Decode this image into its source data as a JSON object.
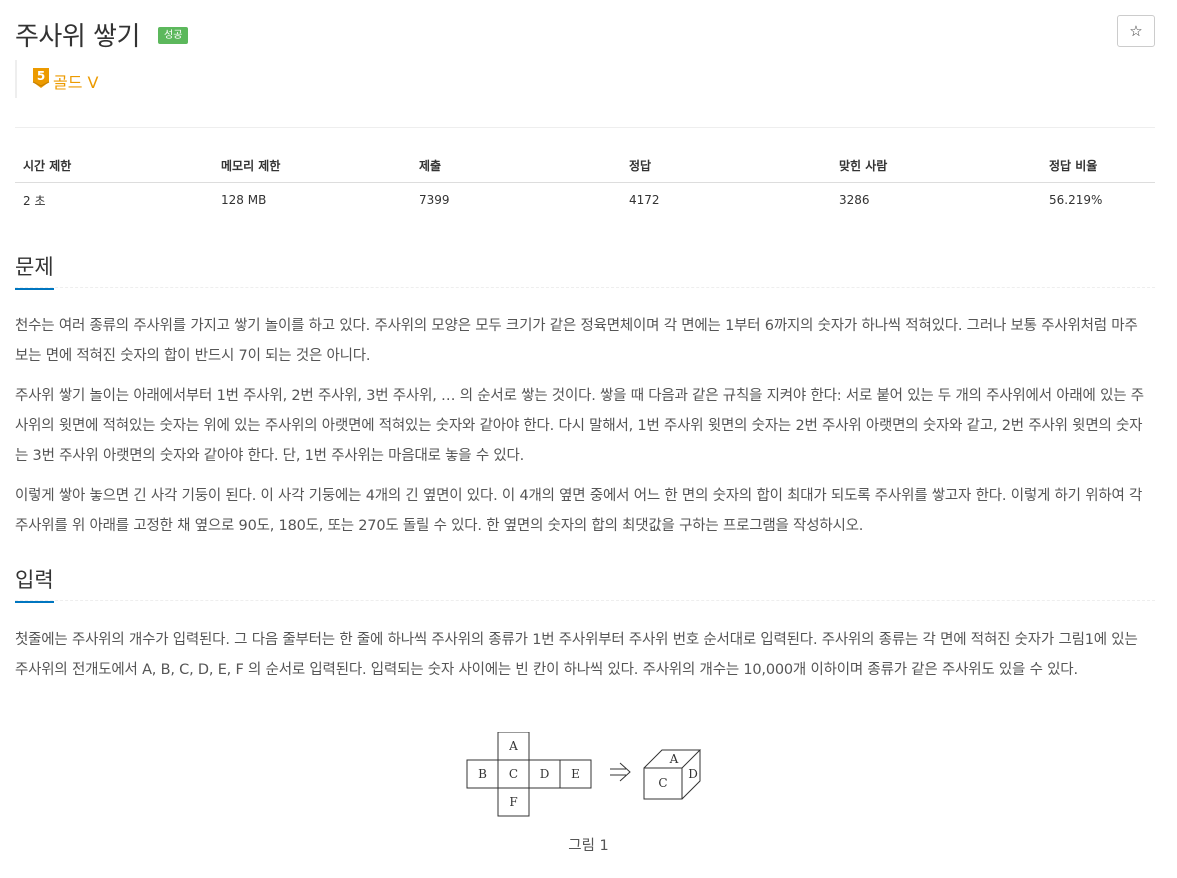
{
  "problem": {
    "title": "주사위 쌓기",
    "status_badge": "성공",
    "star_icon": "star-icon",
    "tier": {
      "level": "5",
      "label": "골드 V",
      "color": "#ec9a00"
    }
  },
  "info_table": {
    "headers": [
      "시간 제한",
      "메모리 제한",
      "제출",
      "정답",
      "맞힌 사람",
      "정답 비율"
    ],
    "values": [
      "2 초",
      "128 MB",
      "7399",
      "4172",
      "3286",
      "56.219%"
    ]
  },
  "sections": {
    "problem": {
      "heading": "문제",
      "paragraphs": [
        "천수는 여러 종류의 주사위를 가지고 쌓기 놀이를 하고 있다. 주사위의 모양은 모두 크기가 같은 정육면체이며 각 면에는 1부터 6까지의 숫자가 하나씩 적혀있다. 그러나 보통 주사위처럼 마주 보는 면에 적혀진 숫자의 합이 반드시 7이 되는 것은 아니다.",
        "주사위 쌓기 놀이는 아래에서부터 1번 주사위, 2번 주사위, 3번 주사위, … 의 순서로 쌓는 것이다. 쌓을 때 다음과 같은 규칙을 지켜야 한다: 서로 붙어 있는 두 개의 주사위에서 아래에 있는 주사위의 윗면에 적혀있는 숫자는 위에 있는 주사위의 아랫면에 적혀있는 숫자와 같아야 한다. 다시 말해서, 1번 주사위 윗면의 숫자는 2번 주사위 아랫면의 숫자와 같고, 2번 주사위 윗면의 숫자는 3번 주사위 아랫면의 숫자와 같아야 한다. 단, 1번 주사위는 마음대로 놓을 수 있다.",
        "이렇게 쌓아 놓으면 긴 사각 기둥이 된다. 이 사각 기둥에는 4개의 긴 옆면이 있다. 이 4개의 옆면 중에서 어느 한 면의 숫자의 합이 최대가 되도록 주사위를 쌓고자 한다. 이렇게 하기 위하여 각 주사위를 위 아래를 고정한 채 옆으로 90도, 180도, 또는 270도 돌릴 수 있다. 한 옆면의 숫자의 합의 최댓값을 구하는 프로그램을 작성하시오."
      ]
    },
    "input": {
      "heading": "입력",
      "paragraphs": [
        "첫줄에는 주사위의 개수가 입력된다. 그 다음 줄부터는 한 줄에 하나씩 주사위의 종류가 1번 주사위부터 주사위 번호 순서대로 입력된다. 주사위의 종류는 각 면에 적혀진 숫자가 그림1에 있는 주사위의 전개도에서 A, B, C, D, E, F 의 순서로 입력된다. 입력되는 숫자 사이에는 빈 칸이 하나씩 있다. 주사위의 개수는 10,000개 이하이며 종류가 같은 주사위도 있을 수 있다."
      ]
    }
  },
  "figure": {
    "net_faces": {
      "a": "A",
      "b": "B",
      "c": "C",
      "d": "D",
      "e": "E",
      "f": "F"
    },
    "cube_faces": {
      "top": "A",
      "front": "C",
      "right": "D"
    },
    "arrow_icon": "double-arrow-right-icon",
    "caption": "그림 1"
  }
}
